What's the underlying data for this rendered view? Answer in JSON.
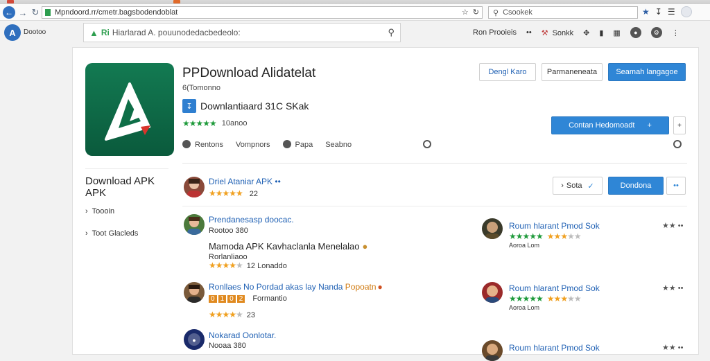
{
  "browser": {
    "url": "Mpndoord.rr/cmetr.bagsbodendoblat",
    "search_placeholder": "Csookek",
    "icons": [
      "back-icon",
      "forward-icon",
      "reload-icon",
      "home-icon",
      "bookmark-star-icon",
      "refresh-icon",
      "star-icon",
      "download-icon",
      "menu-icon",
      "profile-icon"
    ]
  },
  "toolbar": {
    "logo_text": "Dootoo",
    "search_prefix": "Ri",
    "search_value": "Hiarlarad A. pouunodedacbedeolo:",
    "right_items": [
      {
        "label": "Ron Prooieis"
      },
      {
        "label": "Sonkk"
      }
    ]
  },
  "app": {
    "title": "PPDownload Alidatelat",
    "subtitle": "6(Tomonno",
    "download_label": "Downlantiaard 31C SKak",
    "rating_count": "10anoo",
    "meta": [
      "Rentons",
      "Vompnors",
      "Papa",
      "Seabno"
    ],
    "brand_color": "#0f6d48",
    "buttons": {
      "dengl_karo": "Dengl Karo",
      "permissions": "Parmaneneata",
      "search_language": "Seamah langagoe",
      "contain_download": "Contan Hedomoadt",
      "plus": "+"
    }
  },
  "sidebar": {
    "title": "Download APK APK",
    "items": [
      {
        "label": "Toooin"
      },
      {
        "label": "Toot Glacleds"
      }
    ]
  },
  "filter_bar": {
    "sort": "Sota",
    "button": "Dondona",
    "more": "••"
  },
  "reviews": [
    {
      "name": "Driel Ataniar APK ••",
      "count": "22"
    },
    {
      "name": "Prendanesasp doocac.",
      "line": "Rootoo 380",
      "text": "Mamoda APK Kavhaclanla Menelalao",
      "sub": "Rorlanliaoo",
      "count": "12 Lonaddo"
    },
    {
      "name": "Ronllaes No Pordad akas lay Nanda",
      "highlight": "Popoatn",
      "tags": [
        "0",
        "1",
        "0",
        "2"
      ],
      "line": "Formantio",
      "count": "23"
    },
    {
      "name": "Nokarad Oonlotar.",
      "line": "Nooaa 380"
    }
  ],
  "side_reviews": [
    {
      "name": "Roum hlarant Pmod Sok",
      "line": "Aoroa Lom",
      "more": "★★ ••"
    },
    {
      "name": "Roum hlarant Pmod Sok",
      "line": "Aoroa Lom",
      "more": "★★ ••"
    },
    {
      "name": "Roum hlarant Pmod Sok",
      "more": "★★ ••"
    }
  ],
  "colors": {
    "accent_blue": "#2f86d6",
    "star_green": "#1e9a3a",
    "star_yellow": "#f0a020"
  }
}
